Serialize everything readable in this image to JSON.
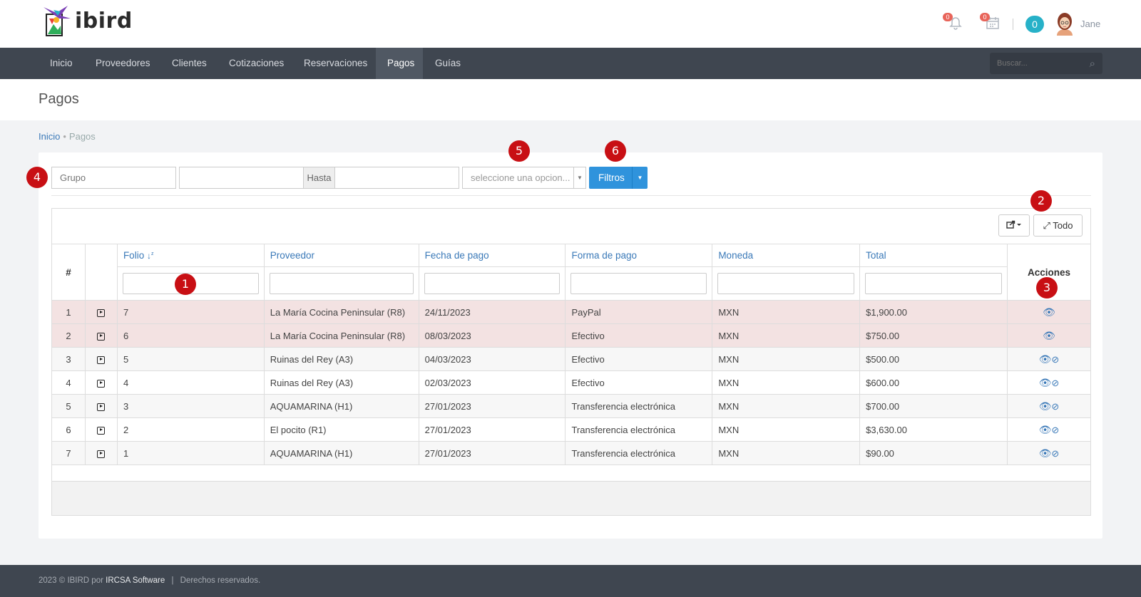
{
  "brand": {
    "name": "ibird"
  },
  "header": {
    "notifications_count": "0",
    "calendar_count": "0",
    "messages_count": "0",
    "user_name": "Jane"
  },
  "nav": {
    "items": [
      "Inicio",
      "Proveedores",
      "Clientes",
      "Cotizaciones",
      "Reservaciones",
      "Pagos",
      "Guías"
    ],
    "active": "Pagos",
    "search_placeholder": "Buscar..."
  },
  "page": {
    "title": "Pagos"
  },
  "breadcrumb": {
    "home": "Inicio",
    "current": "Pagos"
  },
  "filters": {
    "group_placeholder": "Grupo",
    "date_from_value": "",
    "hasta_label": "Hasta",
    "date_to_value": "",
    "select_placeholder": "seleccione una opcion...",
    "filter_button": "Filtros"
  },
  "toolbar": {
    "expand_label": "Todo"
  },
  "table": {
    "columns": {
      "hash": "#",
      "folio": "Folio",
      "proveedor": "Proveedor",
      "fecha": "Fecha de pago",
      "forma": "Forma de pago",
      "moneda": "Moneda",
      "total": "Total",
      "acciones": "Acciones"
    },
    "rows": [
      {
        "n": "1",
        "folio": "7",
        "proveedor": "La María Cocina Peninsular (R8)",
        "fecha": "24/11/2023",
        "forma": "PayPal",
        "moneda": "MXN",
        "total": "$1,900.00"
      },
      {
        "n": "2",
        "folio": "6",
        "proveedor": "La María Cocina Peninsular (R8)",
        "fecha": "08/03/2023",
        "forma": "Efectivo",
        "moneda": "MXN",
        "total": "$750.00"
      },
      {
        "n": "3",
        "folio": "5",
        "proveedor": "Ruinas del Rey (A3)",
        "fecha": "04/03/2023",
        "forma": "Efectivo",
        "moneda": "MXN",
        "total": "$500.00"
      },
      {
        "n": "4",
        "folio": "4",
        "proveedor": "Ruinas del Rey (A3)",
        "fecha": "02/03/2023",
        "forma": "Efectivo",
        "moneda": "MXN",
        "total": "$600.00"
      },
      {
        "n": "5",
        "folio": "3",
        "proveedor": "AQUAMARINA (H1)",
        "fecha": "27/01/2023",
        "forma": "Transferencia electrónica",
        "moneda": "MXN",
        "total": "$700.00"
      },
      {
        "n": "6",
        "folio": "2",
        "proveedor": "El pocito (R1)",
        "fecha": "27/01/2023",
        "forma": "Transferencia electrónica",
        "moneda": "MXN",
        "total": "$3,630.00"
      },
      {
        "n": "7",
        "folio": "1",
        "proveedor": "AQUAMARINA (H1)",
        "fecha": "27/01/2023",
        "forma": "Transferencia electrónica",
        "moneda": "MXN",
        "total": "$90.00"
      }
    ]
  },
  "markers": [
    "1",
    "2",
    "3",
    "4",
    "5",
    "6"
  ],
  "footer": {
    "text_before": "2023 © IBIRD por",
    "company": "IRCSA Software",
    "separator": "|",
    "rights": "Derechos reservados."
  }
}
